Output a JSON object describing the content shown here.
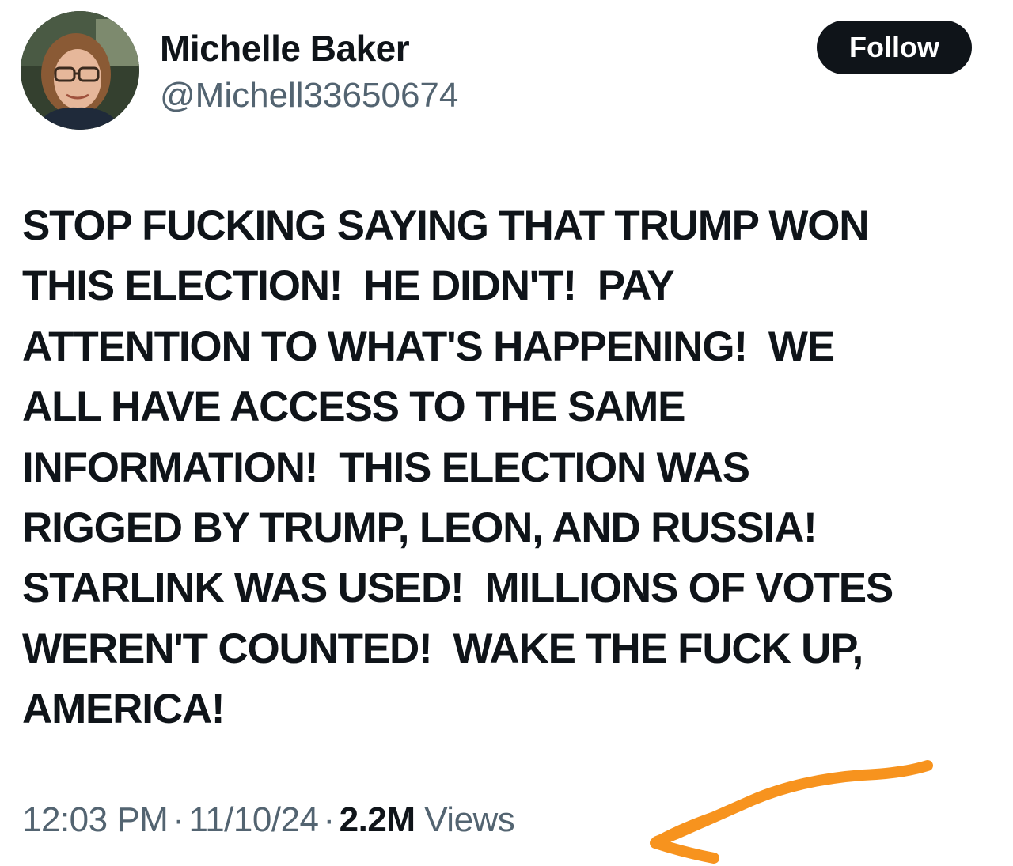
{
  "author": {
    "name": "Michelle Baker",
    "handle": "@Michell33650674"
  },
  "follow_label": "Follow",
  "tweet": {
    "lines": [
      "STOP FUCKING SAYING THAT TRUMP WON",
      "THIS ELECTION!  HE DIDN'T!  PAY",
      "ATTENTION TO WHAT'S HAPPENING!  WE",
      "ALL HAVE ACCESS TO THE SAME",
      "INFORMATION!  THIS ELECTION WAS",
      "RIGGED BY TRUMP, LEON, AND RUSSIA!",
      "STARLINK WAS USED!  MILLIONS OF VOTES",
      "WEREN'T COUNTED!  WAKE THE FUCK UP,",
      "AMERICA!"
    ]
  },
  "meta": {
    "time": "12:03 PM",
    "separator": "·",
    "date": "11/10/24",
    "views_count": "2.2M",
    "views_label": "Views"
  },
  "colors": {
    "text_primary": "#0f1419",
    "text_secondary": "#536471",
    "follow_bg": "#0f1419",
    "annotation_arrow": "#f7931e"
  },
  "icons": {
    "avatar": "profile-photo",
    "annotation": "hand-drawn-arrow-icon"
  }
}
